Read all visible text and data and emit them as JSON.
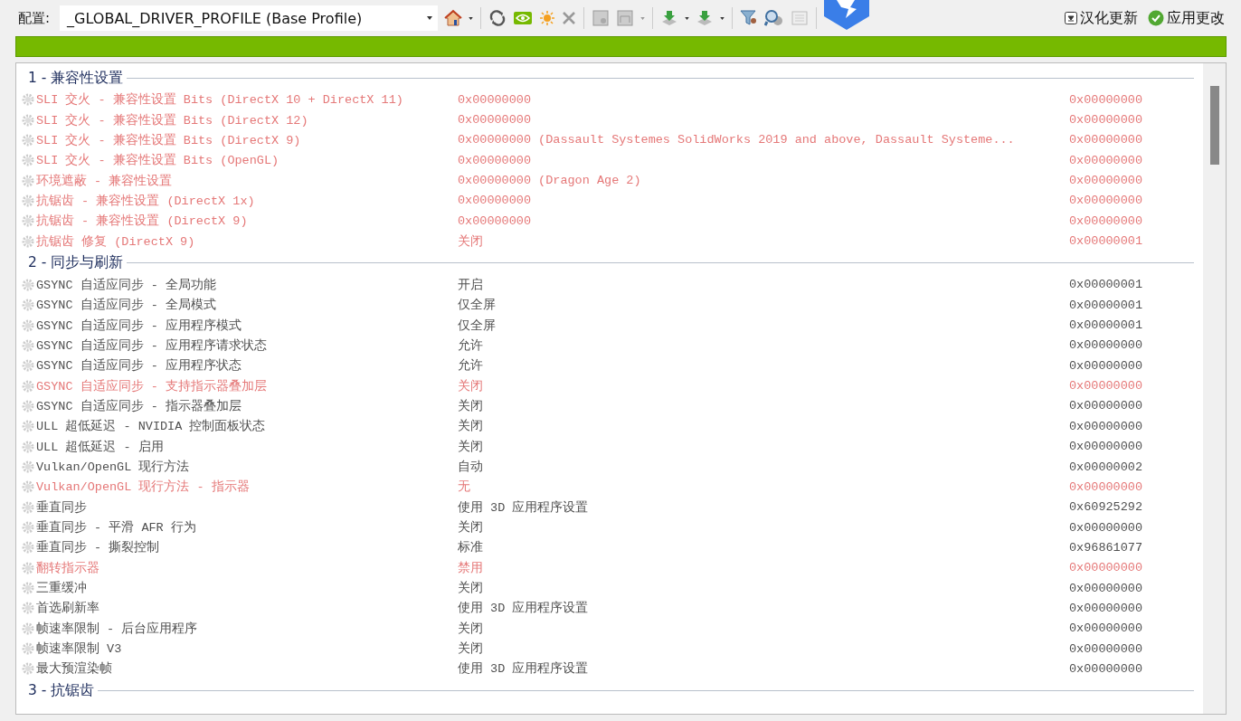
{
  "toolbar": {
    "profile_label": "配置:",
    "profile_value": "_GLOBAL_DRIVER_PROFILE (Base Profile)",
    "update_button": "汉化更新",
    "apply_button": "应用更改"
  },
  "sections": [
    {
      "title": "1 - 兼容性设置",
      "rows": [
        {
          "name": "SLI 交火 - 兼容性设置 Bits (DirectX 10 + DirectX 11)",
          "value": "0x00000000",
          "hex": "0x00000000",
          "flagged": true
        },
        {
          "name": "SLI 交火 - 兼容性设置 Bits (DirectX 12)",
          "value": "0x00000000",
          "hex": "0x00000000",
          "flagged": true
        },
        {
          "name": "SLI 交火 - 兼容性设置 Bits (DirectX 9)",
          "value": "0x00000000 (Dassault Systemes SolidWorks 2019 and above, Dassault Systeme...",
          "hex": "0x00000000",
          "flagged": true
        },
        {
          "name": "SLI 交火 - 兼容性设置 Bits (OpenGL)",
          "value": "0x00000000",
          "hex": "0x00000000",
          "flagged": true
        },
        {
          "name": "环境遮蔽 - 兼容性设置",
          "value": "0x00000000 (Dragon Age 2)",
          "hex": "0x00000000",
          "flagged": true
        },
        {
          "name": "抗锯齿 - 兼容性设置 (DirectX 1x)",
          "value": "0x00000000",
          "hex": "0x00000000",
          "flagged": true
        },
        {
          "name": "抗锯齿 - 兼容性设置 (DirectX 9)",
          "value": "0x00000000",
          "hex": "0x00000000",
          "flagged": true
        },
        {
          "name": "抗锯齿 修复 (DirectX 9)",
          "value": "关闭",
          "hex": "0x00000001",
          "flagged": true
        }
      ]
    },
    {
      "title": "2 - 同步与刷新",
      "rows": [
        {
          "name": "GSYNC 自适应同步 - 全局功能",
          "value": "开启",
          "hex": "0x00000001",
          "flagged": false
        },
        {
          "name": "GSYNC 自适应同步 - 全局模式",
          "value": "仅全屏",
          "hex": "0x00000001",
          "flagged": false
        },
        {
          "name": "GSYNC 自适应同步 - 应用程序模式",
          "value": "仅全屏",
          "hex": "0x00000001",
          "flagged": false
        },
        {
          "name": "GSYNC 自适应同步 - 应用程序请求状态",
          "value": "允许",
          "hex": "0x00000000",
          "flagged": false
        },
        {
          "name": "GSYNC 自适应同步 - 应用程序状态",
          "value": "允许",
          "hex": "0x00000000",
          "flagged": false
        },
        {
          "name": "GSYNC 自适应同步 - 支持指示器叠加层",
          "value": "关闭",
          "hex": "0x00000000",
          "flagged": true
        },
        {
          "name": "GSYNC 自适应同步 - 指示器叠加层",
          "value": "关闭",
          "hex": "0x00000000",
          "flagged": false
        },
        {
          "name": "ULL 超低延迟 - NVIDIA 控制面板状态",
          "value": "关闭",
          "hex": "0x00000000",
          "flagged": false
        },
        {
          "name": "ULL 超低延迟 - 启用",
          "value": "关闭",
          "hex": "0x00000000",
          "flagged": false
        },
        {
          "name": "Vulkan/OpenGL 现行方法",
          "value": "自动",
          "hex": "0x00000002",
          "flagged": false
        },
        {
          "name": "Vulkan/OpenGL 现行方法 - 指示器",
          "value": "无",
          "hex": "0x00000000",
          "flagged": true
        },
        {
          "name": "垂直同步",
          "value": "使用 3D 应用程序设置",
          "hex": "0x60925292",
          "flagged": false
        },
        {
          "name": "垂直同步 - 平滑 AFR 行为",
          "value": "关闭",
          "hex": "0x00000000",
          "flagged": false
        },
        {
          "name": "垂直同步 - 撕裂控制",
          "value": "标准",
          "hex": "0x96861077",
          "flagged": false
        },
        {
          "name": "翻转指示器",
          "value": "禁用",
          "hex": "0x00000000",
          "flagged": true
        },
        {
          "name": "三重缓冲",
          "value": "关闭",
          "hex": "0x00000000",
          "flagged": false
        },
        {
          "name": "首选刷新率",
          "value": "使用 3D 应用程序设置",
          "hex": "0x00000000",
          "flagged": false
        },
        {
          "name": "帧速率限制 - 后台应用程序",
          "value": "关闭",
          "hex": "0x00000000",
          "flagged": false
        },
        {
          "name": "帧速率限制 V3",
          "value": "关闭",
          "hex": "0x00000000",
          "flagged": false
        },
        {
          "name": "最大预渲染帧",
          "value": "使用 3D 应用程序设置",
          "hex": "0x00000000",
          "flagged": false
        }
      ]
    },
    {
      "title": "3 - 抗锯齿"
    }
  ]
}
